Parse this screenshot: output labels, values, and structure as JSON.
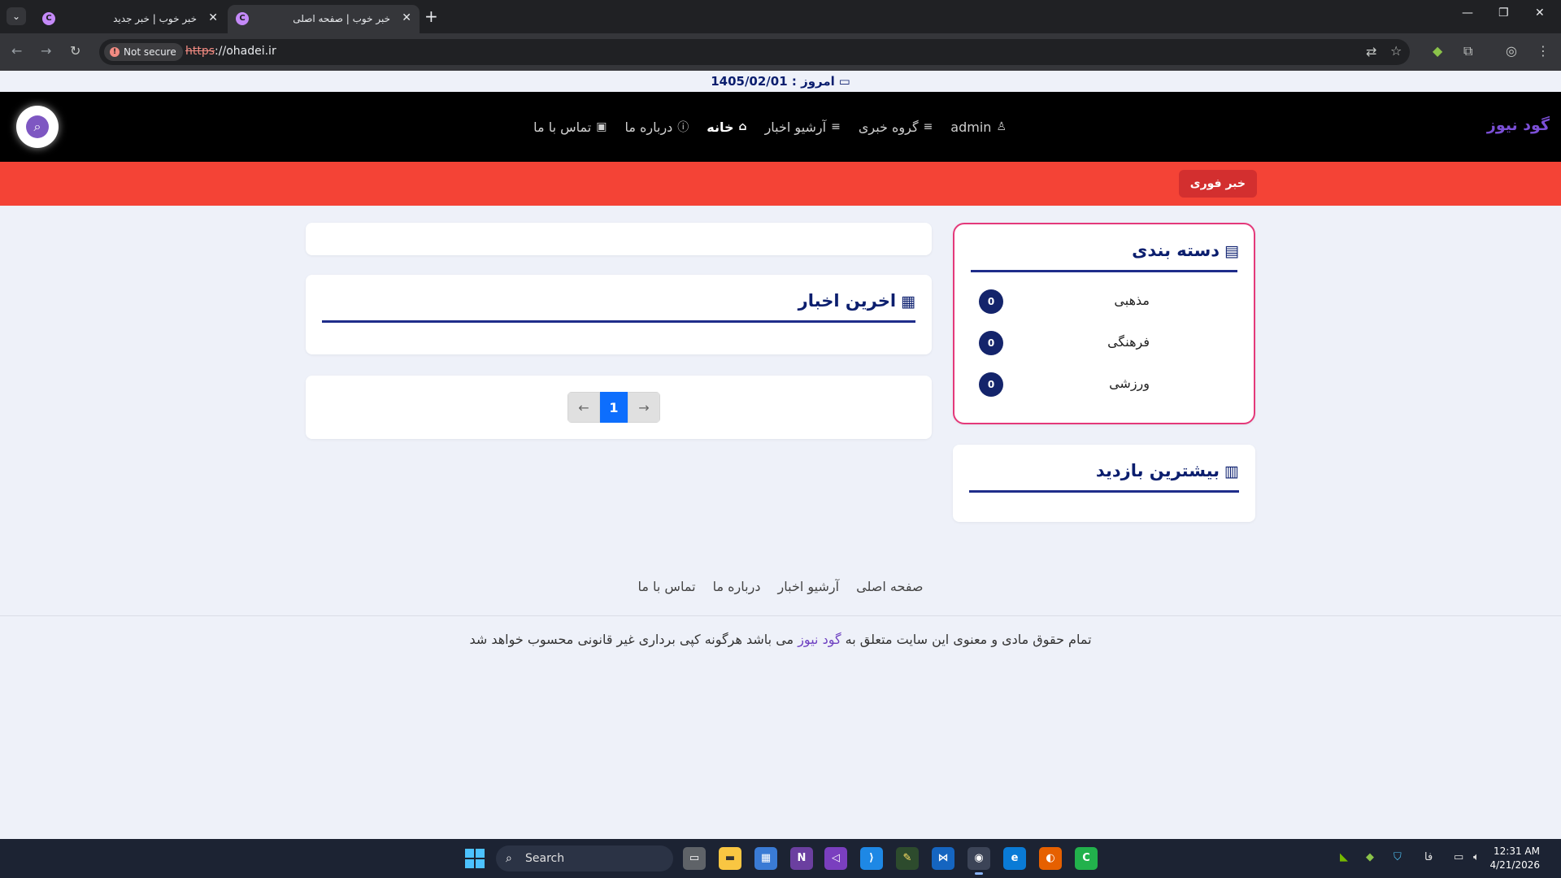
{
  "browser": {
    "tabs": [
      {
        "title": "خبر خوب | خبر جدید",
        "favicon": "C",
        "active": false
      },
      {
        "title": "خبر خوب | صفحه اصلی",
        "favicon": "C",
        "active": true
      }
    ],
    "new_tab": "+",
    "security_label": "Not secure",
    "url_scheme": "https",
    "url_rest": "://ohadei.ir"
  },
  "page": {
    "date_text": "امروز : 1405/02/01",
    "brand": "گود نیوز",
    "nav": [
      {
        "label": "admin",
        "icon": "user-icon"
      },
      {
        "label": "گروه خبری",
        "icon": "menu-lines-icon"
      },
      {
        "label": "آرشیو اخبار",
        "icon": "menu-lines-icon"
      },
      {
        "label": "خانه",
        "icon": "home-icon",
        "active": true
      },
      {
        "label": "درباره ما",
        "icon": "info-icon"
      },
      {
        "label": "تماس با ما",
        "icon": "contact-card-icon"
      }
    ],
    "breaking_label": "خبر فوری",
    "categories": {
      "title": "دسته بندی",
      "items": [
        {
          "label": "مذهبی",
          "count": "0"
        },
        {
          "label": "فرهنگی",
          "count": "0"
        },
        {
          "label": "ورزشی",
          "count": "0"
        }
      ]
    },
    "most_visited_title": "بیشترین بازدید",
    "latest_news_title": "اخرین اخبار",
    "pagination": {
      "prev": "←",
      "current": "1",
      "next": "→"
    },
    "footer_links": [
      "صفحه اصلی",
      "آرشیو اخبار",
      "درباره ما",
      "تماس با ما"
    ],
    "copyright_before": "تمام حقوق مادی و معنوی این سایت متعلق به ",
    "copyright_brand": "گود نیوز",
    "copyright_after": " می باشد هرگونه کپی برداری غیر قانونی محسوب خواهد شد"
  },
  "taskbar": {
    "search_placeholder": "Search",
    "time": "12:31 AM",
    "date": "4/21/2026",
    "lang": "فا"
  },
  "colors": {
    "header_bg": "#000000",
    "breaking_bg": "#f44336",
    "accent_navy": "#0b1e6e",
    "category_border": "#e4397a",
    "brand_purple": "#7b4fd6",
    "pager_active": "#0d6efd"
  }
}
